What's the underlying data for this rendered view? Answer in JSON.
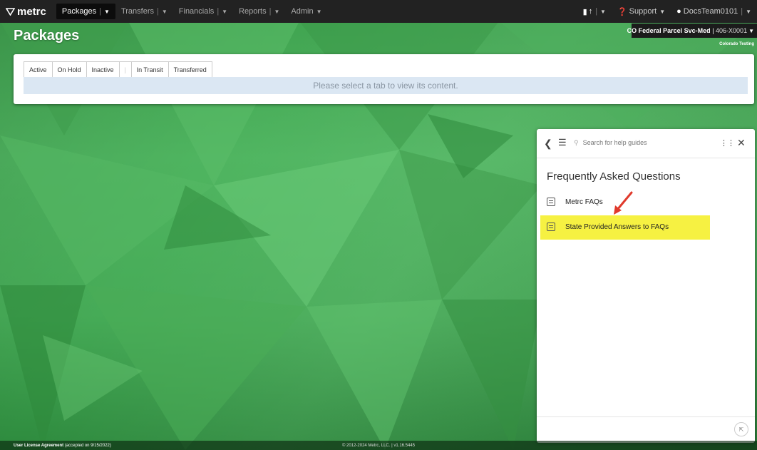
{
  "brand": {
    "name": "metrc"
  },
  "nav": {
    "items": [
      {
        "label": "Packages",
        "active": true
      },
      {
        "label": "Transfers",
        "active": false
      },
      {
        "label": "Financials",
        "active": false
      },
      {
        "label": "Reports",
        "active": false
      },
      {
        "label": "Admin",
        "active": false
      }
    ],
    "support_label": "Support",
    "user_label": "DocsTeam0101"
  },
  "page": {
    "title": "Packages",
    "facility_name": "CO Federal Parcel Svc-Med",
    "facility_license": "406-X0001",
    "region": "Colorado Testing"
  },
  "tabs": {
    "items": [
      "Active",
      "On Hold",
      "Inactive",
      "In Transit",
      "Transferred"
    ],
    "empty_message": "Please select a tab to view its content."
  },
  "help": {
    "search_placeholder": "Search for help guides",
    "section_title": "Frequently Asked Questions",
    "items": [
      "Metrc FAQs",
      "State Provided Answers to FAQs"
    ]
  },
  "footer": {
    "license_link": "User License Agreement",
    "accepted_note": "(accepted on 9/15/2022)",
    "copyright": "© 2012-2024 Metrc, LLC. | v1.16.5445"
  },
  "colors": {
    "navbar": "#222222",
    "highlight": "#f6f142",
    "arrow": "#e03a2c",
    "info_strip": "#dbe7f3"
  }
}
